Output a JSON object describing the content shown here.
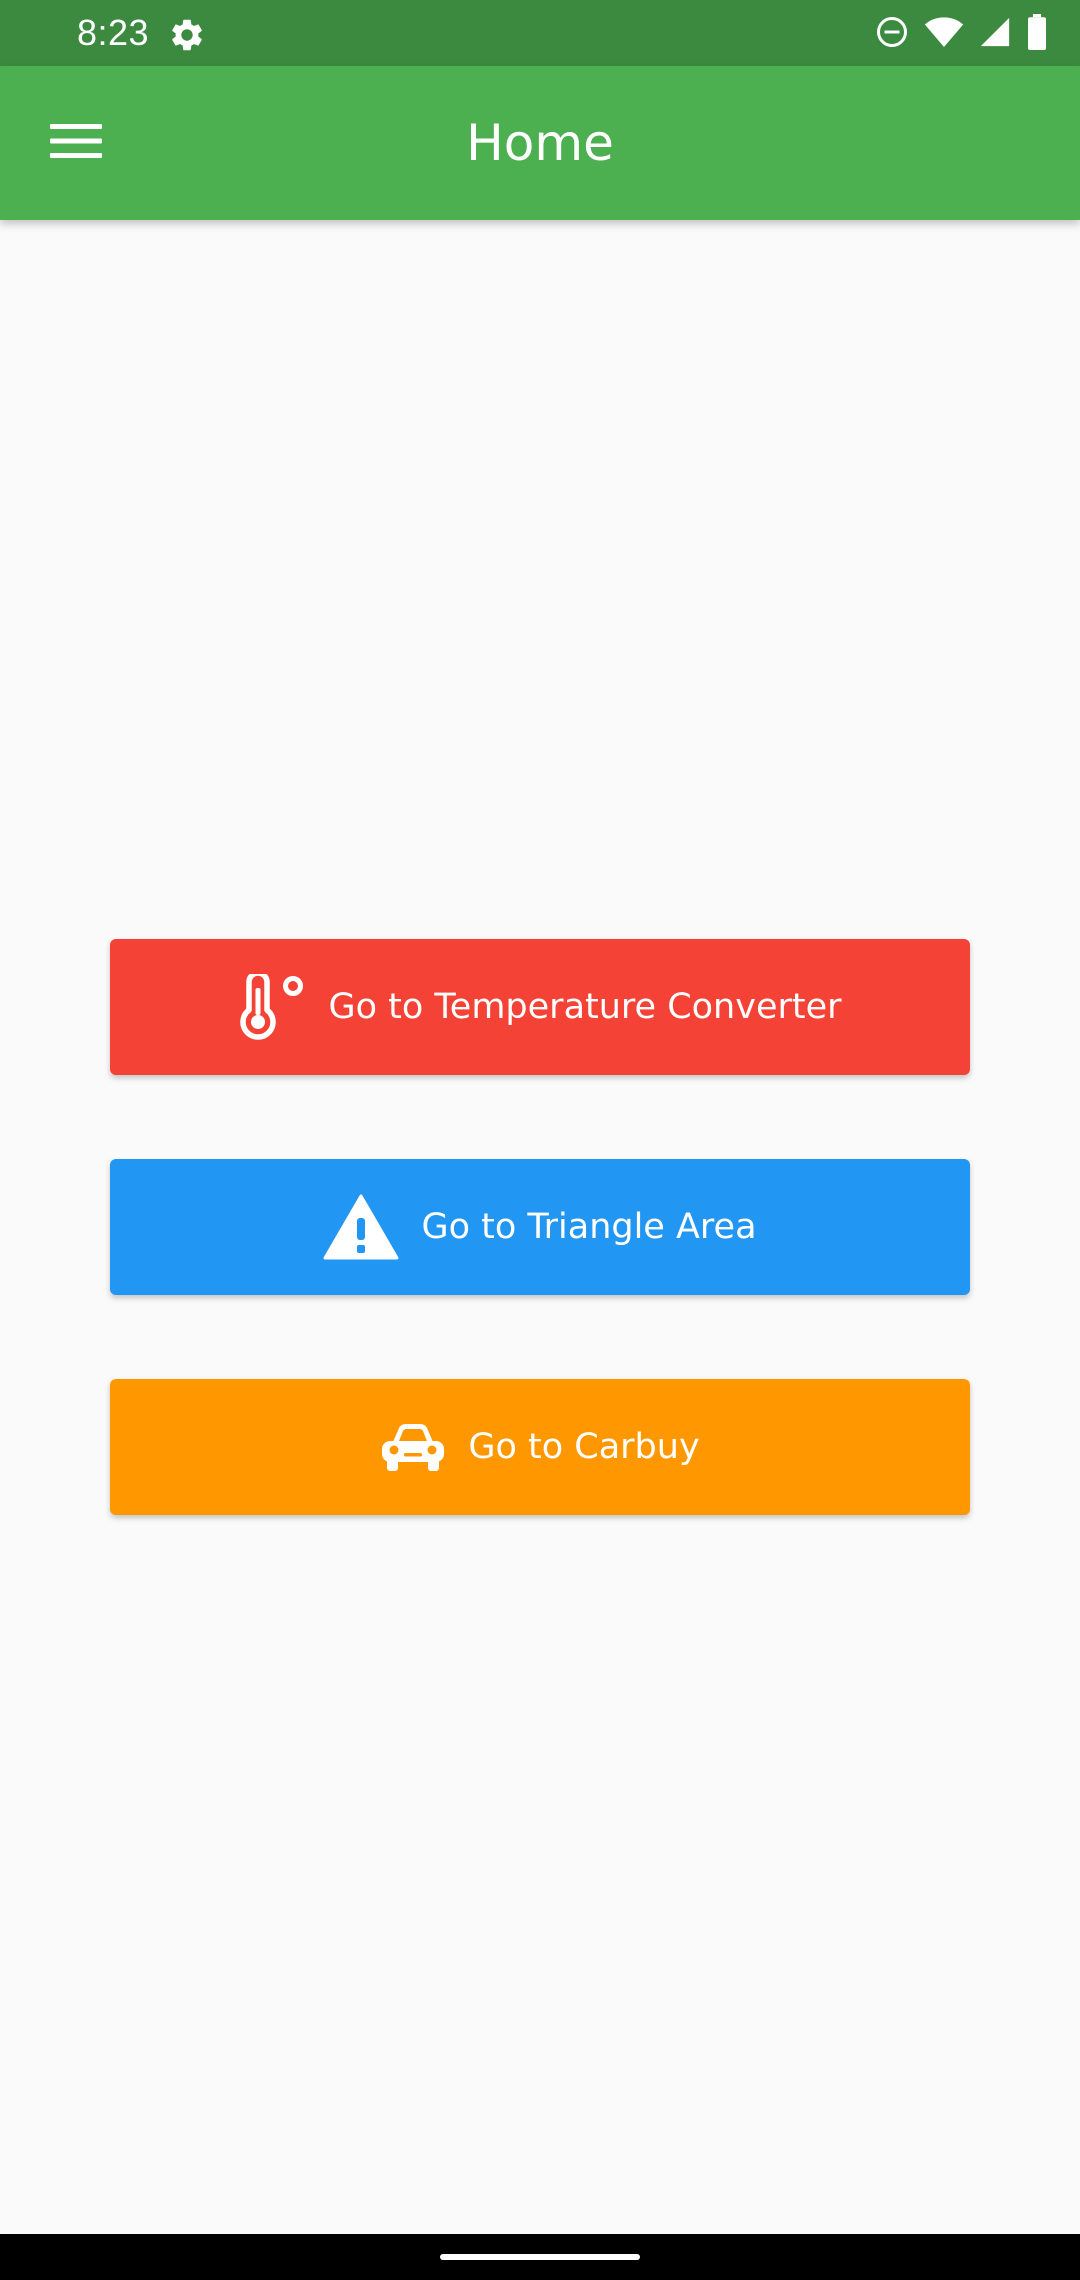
{
  "status_bar": {
    "time": "8:23",
    "background": "#3c8a3f"
  },
  "app_bar": {
    "title": "Home",
    "background": "#4caf50",
    "menu_icon": "hamburger-menu-icon"
  },
  "buttons": [
    {
      "label": "Go to Temperature Converter",
      "color": "#f44336",
      "icon": "thermometer-celsius-icon"
    },
    {
      "label": "Go to Triangle Area",
      "color": "#2196f3",
      "icon": "warning-triangle-icon"
    },
    {
      "label": "Go to Carbuy",
      "color": "#ff9800",
      "icon": "car-icon"
    }
  ]
}
